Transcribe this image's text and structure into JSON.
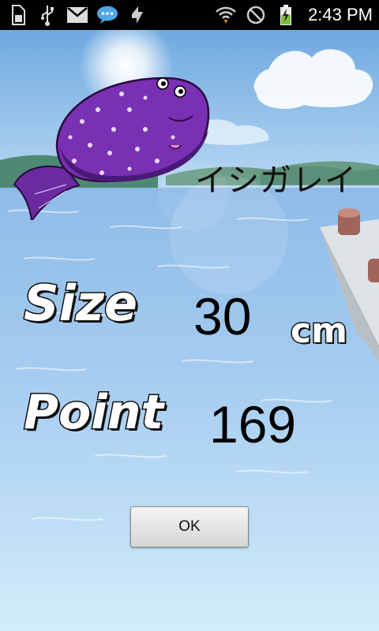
{
  "status_bar": {
    "time": "2:43 PM",
    "icons_left": [
      "sd-card-icon",
      "usb-icon",
      "gmail-icon",
      "chat-icon",
      "sync-icon"
    ],
    "icons_right": [
      "wifi-icon",
      "no-signal-icon",
      "battery-charging-icon"
    ]
  },
  "result": {
    "fish_name": "イシガレイ",
    "size_label": "Size",
    "size_value": "30",
    "size_unit": "cm",
    "point_label": "Point",
    "point_value": "169"
  },
  "ok_button": {
    "label": "OK"
  },
  "colors": {
    "fish_body": "#6a2aa0",
    "sky_top": "#7fb7e8",
    "sea": "#9cc6ec",
    "sea_bottom": "#c8e8f8"
  }
}
